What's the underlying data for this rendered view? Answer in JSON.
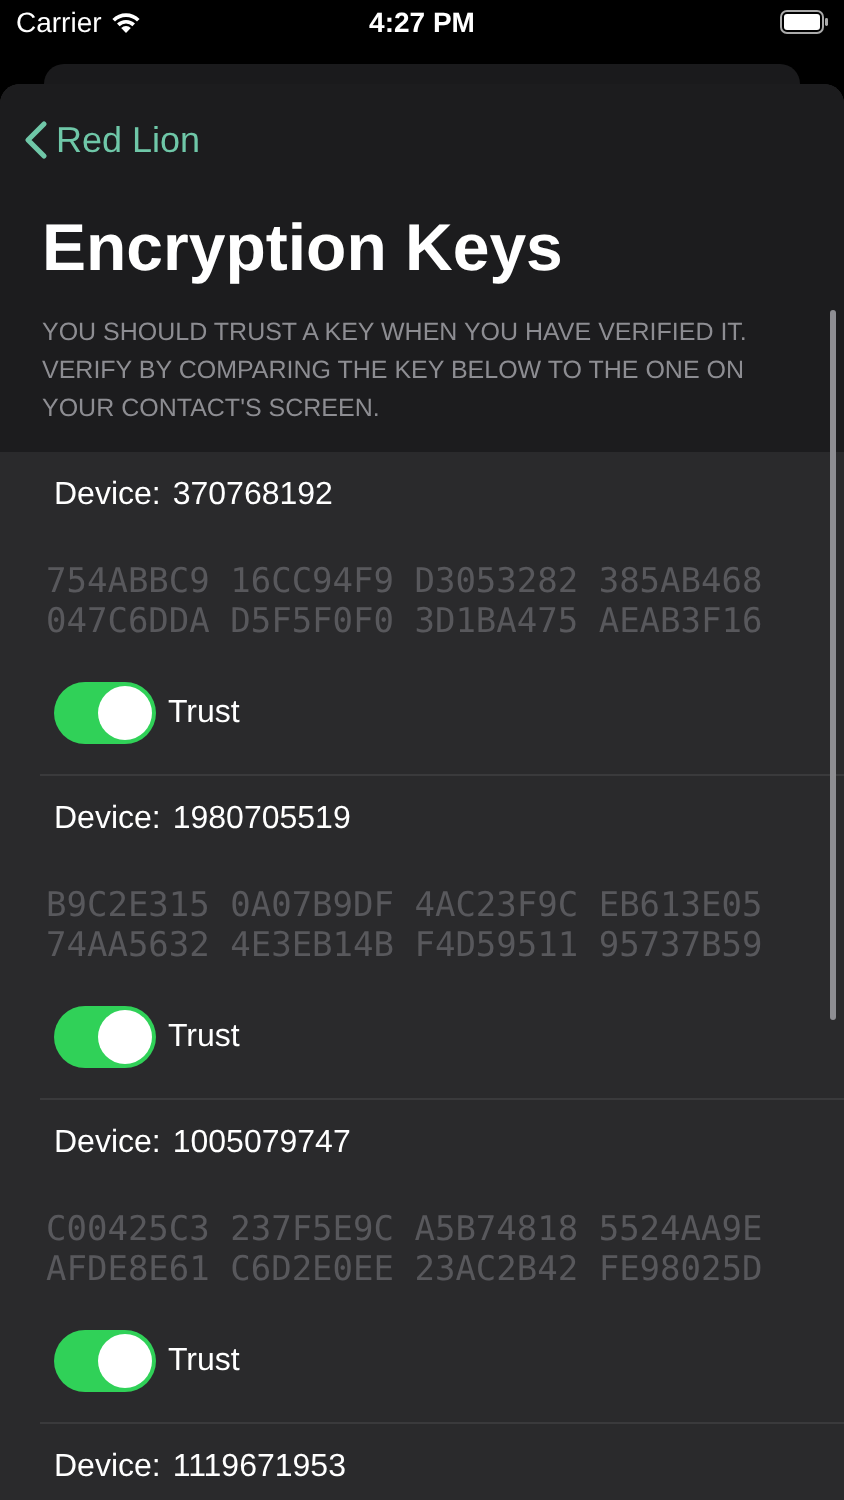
{
  "status_bar": {
    "carrier": "Carrier",
    "time": "4:27 PM"
  },
  "nav": {
    "back_label": "Red Lion",
    "title": "Encryption Keys"
  },
  "note": "YOU SHOULD TRUST A KEY WHEN YOU HAVE VERIFIED IT. VERIFY BY COMPARING THE KEY BELOW TO THE ONE ON YOUR CONTACT'S SCREEN.",
  "devices": [
    {
      "label": "Device:",
      "id": "370768192",
      "key_lines": [
        "754ABBC9 16CC94F9 D3053282 385AB468",
        "047C6DDA D5F5F0F0 3D1BA475 AEAB3F16"
      ],
      "toggle_label": "Trust",
      "on": true
    },
    {
      "label": "Device:",
      "id": "1980705519",
      "key_lines": [
        "B9C2E315 0A07B9DF 4AC23F9C EB613E05",
        "74AA5632 4E3EB14B F4D59511 95737B59"
      ],
      "toggle_label": "Trust",
      "on": true
    },
    {
      "label": "Device:",
      "id": "1005079747",
      "key_lines": [
        "C00425C3 237F5E9C A5B74818 5524AA9E",
        "AFDE8E61 C6D2E0EE 23AC2B42 FE98025D"
      ],
      "toggle_label": "Trust",
      "on": true
    },
    {
      "label": "Device:",
      "id": "1119671953"
    }
  ]
}
